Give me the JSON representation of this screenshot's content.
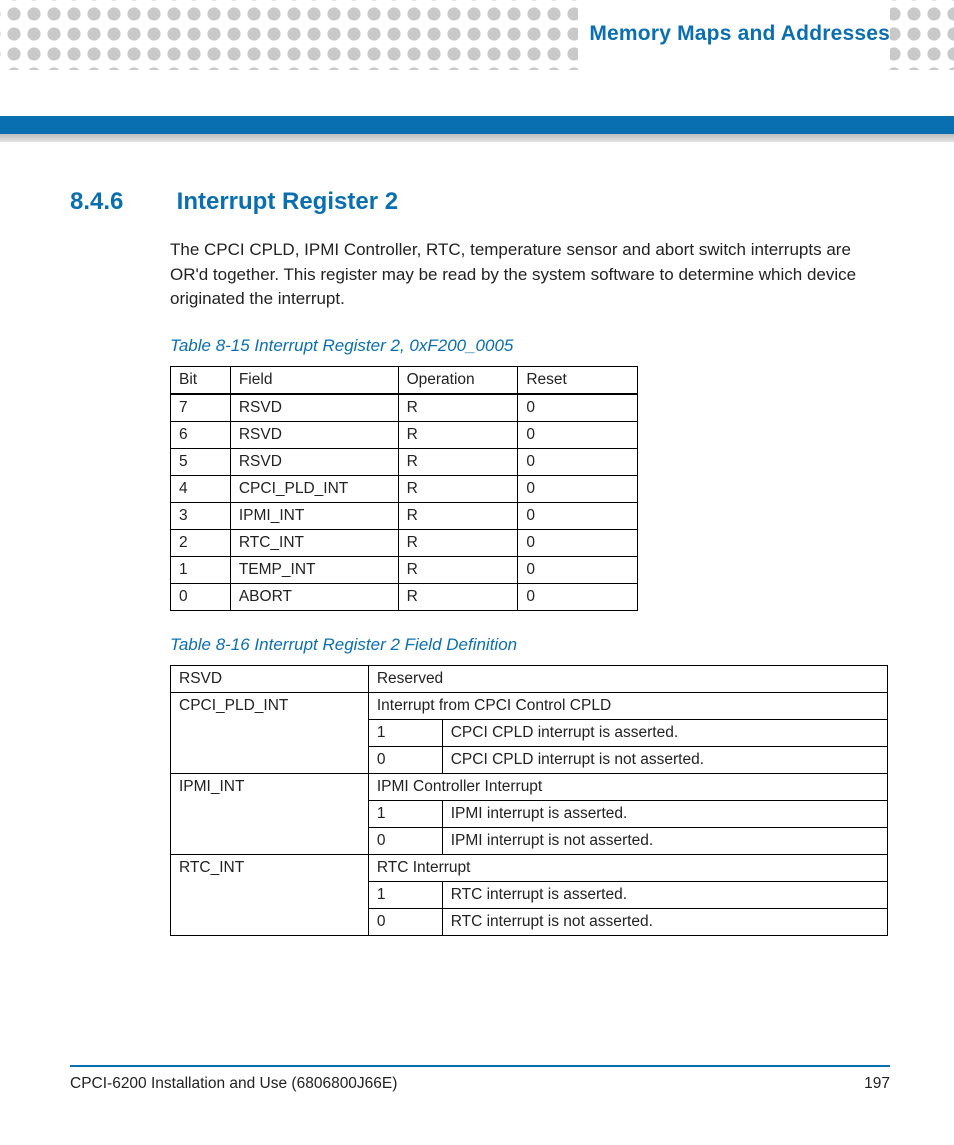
{
  "running_head": "Memory Maps and Addresses",
  "section": {
    "number": "8.4.6",
    "title": "Interrupt Register 2"
  },
  "paragraph": "The CPCI CPLD, IPMI Controller, RTC, temperature sensor and abort switch interrupts are OR'd together. This register may be read by the system software to determine which device originated the interrupt.",
  "table1": {
    "caption": "Table 8-15 Interrupt Register 2, 0xF200_0005",
    "headers": {
      "bit": "Bit",
      "field": "Field",
      "operation": "Operation",
      "reset": "Reset"
    },
    "rows": [
      {
        "bit": "7",
        "field": "RSVD",
        "operation": "R",
        "reset": "0"
      },
      {
        "bit": "6",
        "field": "RSVD",
        "operation": "R",
        "reset": "0"
      },
      {
        "bit": "5",
        "field": "RSVD",
        "operation": "R",
        "reset": "0"
      },
      {
        "bit": "4",
        "field": "CPCI_PLD_INT",
        "operation": "R",
        "reset": "0"
      },
      {
        "bit": "3",
        "field": "IPMI_INT",
        "operation": "R",
        "reset": "0"
      },
      {
        "bit": "2",
        "field": "RTC_INT",
        "operation": "R",
        "reset": "0"
      },
      {
        "bit": "1",
        "field": "TEMP_INT",
        "operation": "R",
        "reset": "0"
      },
      {
        "bit": "0",
        "field": "ABORT",
        "operation": "R",
        "reset": "0"
      }
    ]
  },
  "table2": {
    "caption": "Table 8-16 Interrupt Register 2 Field Definition",
    "entries": [
      {
        "name": "RSVD",
        "desc": "Reserved",
        "values": []
      },
      {
        "name": "CPCI_PLD_INT",
        "desc": "Interrupt from CPCI Control CPLD",
        "values": [
          {
            "v": "1",
            "m": "CPCI CPLD interrupt is asserted."
          },
          {
            "v": "0",
            "m": "CPCI CPLD interrupt is not asserted."
          }
        ]
      },
      {
        "name": "IPMI_INT",
        "desc": "IPMI Controller Interrupt",
        "values": [
          {
            "v": "1",
            "m": "IPMI interrupt is asserted."
          },
          {
            "v": "0",
            "m": "IPMI interrupt is not asserted."
          }
        ]
      },
      {
        "name": "RTC_INT",
        "desc": "RTC Interrupt",
        "values": [
          {
            "v": "1",
            "m": "RTC interrupt is asserted."
          },
          {
            "v": "0",
            "m": "RTC interrupt is not asserted."
          }
        ]
      }
    ]
  },
  "footer": {
    "doc": "CPCI-6200 Installation and Use (6806800J66E)",
    "page": "197"
  }
}
